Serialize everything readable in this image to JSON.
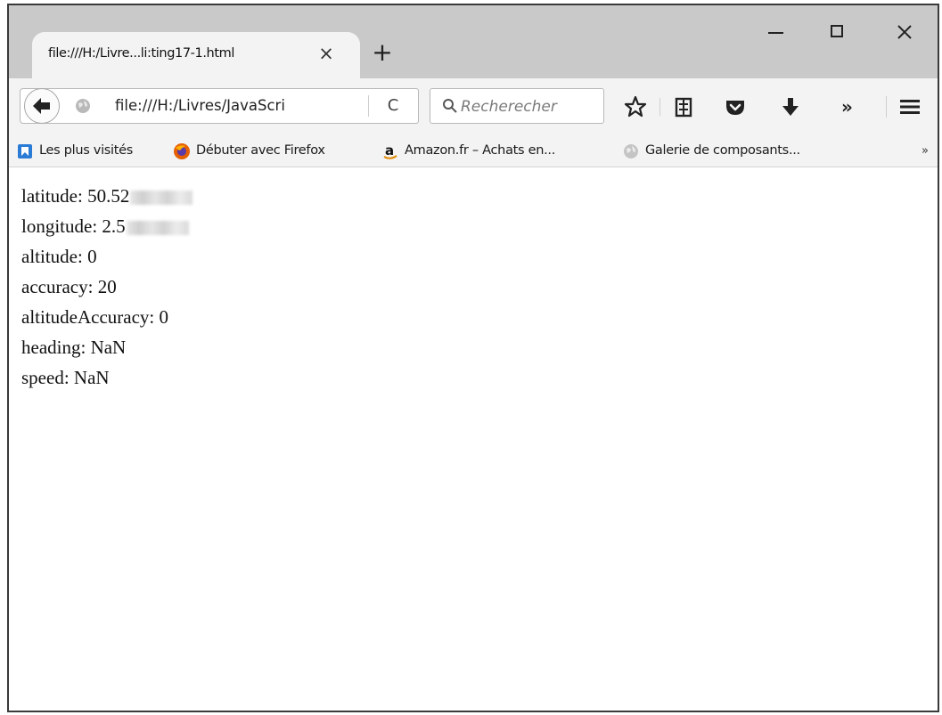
{
  "tab": {
    "title": "file:///H:/Livre...li:ting17-1.html",
    "close_label": "×",
    "new_tab_label": "+"
  },
  "window_controls": {
    "close_label": "✕"
  },
  "navbar": {
    "url": "file:///H:/Livres/JavaScri",
    "reload_label": "C",
    "search_placeholder": "Recherecher",
    "overflow_label": "»",
    "icons": [
      "back-arrow-icon",
      "globe-icon",
      "reload-icon",
      "search-icon",
      "star-icon",
      "reading-list-icon",
      "pocket-icon",
      "download-icon",
      "overflow-icon",
      "menu-icon"
    ]
  },
  "bookmarks": {
    "items": [
      {
        "label": "Les plus visités",
        "icon": "bookmark-blue-icon"
      },
      {
        "label": "Débuter avec Firefox",
        "icon": "firefox-icon"
      },
      {
        "label": "Amazon.fr – Achats en...",
        "icon": "amazon-icon"
      },
      {
        "label": "Galerie de composants...",
        "icon": "globe-gray-icon"
      }
    ],
    "overflow_label": "»"
  },
  "content": {
    "lines": [
      {
        "label": "latitude:",
        "value": "50.52",
        "redacted": true
      },
      {
        "label": "longitude:",
        "value": "2.5",
        "redacted": true
      },
      {
        "label": "altitude:",
        "value": "0"
      },
      {
        "label": "accuracy:",
        "value": "20"
      },
      {
        "label": "altitudeAccuracy:",
        "value": "0"
      },
      {
        "label": "heading:",
        "value": "NaN"
      },
      {
        "label": "speed:",
        "value": "NaN"
      }
    ]
  },
  "colors": {
    "titlebar": "#c9c9c9",
    "toolbar": "#f3f3f3",
    "firefox_orange": "#e66000",
    "bookmark_blue": "#2a7bd6"
  }
}
